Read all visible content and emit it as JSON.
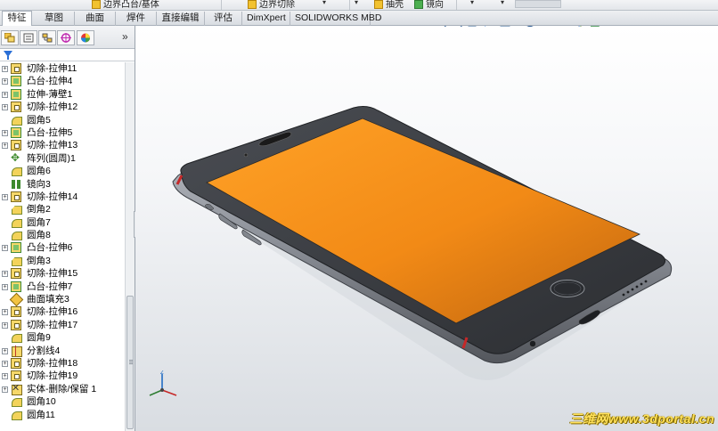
{
  "top_strip": {
    "items": [
      {
        "label": "边界凸台/基体"
      },
      {
        "label": "边界切除"
      },
      {
        "label": "抽壳"
      },
      {
        "label": "镜向"
      }
    ]
  },
  "tabs": [
    {
      "label": "特征",
      "active": true
    },
    {
      "label": "草图",
      "active": false
    },
    {
      "label": "曲面",
      "active": false
    },
    {
      "label": "焊件",
      "active": false
    },
    {
      "label": "直接编辑",
      "active": false
    },
    {
      "label": "评估",
      "active": false
    },
    {
      "label": "DimXpert",
      "active": false
    },
    {
      "label": "SOLIDWORKS MBD",
      "active": false
    }
  ],
  "feature_manager": {
    "toolbar_icons": [
      "featuremanager-tree-icon",
      "property-manager-icon",
      "configuration-manager-icon",
      "dimxpert-manager-icon",
      "display-manager-icon"
    ],
    "more": "»",
    "tree": [
      {
        "label": "切除-拉伸11",
        "icon": "cut",
        "expandable": true
      },
      {
        "label": "凸台-拉伸4",
        "icon": "boss",
        "expandable": true
      },
      {
        "label": "拉伸-薄壁1",
        "icon": "boss",
        "expandable": true
      },
      {
        "label": "切除-拉伸12",
        "icon": "cut",
        "expandable": true
      },
      {
        "label": "圆角5",
        "icon": "fillet",
        "expandable": false
      },
      {
        "label": "凸台-拉伸5",
        "icon": "boss",
        "expandable": true
      },
      {
        "label": "切除-拉伸13",
        "icon": "cut",
        "expandable": true
      },
      {
        "label": "阵列(圆周)1",
        "icon": "pattern",
        "expandable": false
      },
      {
        "label": "圆角6",
        "icon": "fillet",
        "expandable": false
      },
      {
        "label": "镜向3",
        "icon": "mirror",
        "expandable": false
      },
      {
        "label": "切除-拉伸14",
        "icon": "cut",
        "expandable": true
      },
      {
        "label": "倒角2",
        "icon": "chamfer",
        "expandable": false
      },
      {
        "label": "圆角7",
        "icon": "fillet",
        "expandable": false
      },
      {
        "label": "圆角8",
        "icon": "fillet",
        "expandable": false
      },
      {
        "label": "凸台-拉伸6",
        "icon": "boss",
        "expandable": true
      },
      {
        "label": "倒角3",
        "icon": "chamfer",
        "expandable": false
      },
      {
        "label": "切除-拉伸15",
        "icon": "cut",
        "expandable": true
      },
      {
        "label": "凸台-拉伸7",
        "icon": "boss",
        "expandable": true
      },
      {
        "label": "曲面填充3",
        "icon": "surf",
        "expandable": false
      },
      {
        "label": "切除-拉伸16",
        "icon": "cut",
        "expandable": true
      },
      {
        "label": "切除-拉伸17",
        "icon": "cut",
        "expandable": true
      },
      {
        "label": "圆角9",
        "icon": "fillet",
        "expandable": false
      },
      {
        "label": "分割线4",
        "icon": "split",
        "expandable": true
      },
      {
        "label": "切除-拉伸18",
        "icon": "cut",
        "expandable": true
      },
      {
        "label": "切除-拉伸19",
        "icon": "cut",
        "expandable": true
      },
      {
        "label": "实体-删除/保留 1",
        "icon": "body",
        "expandable": true
      },
      {
        "label": "圆角10",
        "icon": "fillet",
        "expandable": false
      },
      {
        "label": "圆角11",
        "icon": "fillet",
        "expandable": false
      }
    ]
  },
  "heads_up_toolbar": [
    "zoom-to-fit-icon",
    "zoom-area-icon",
    "previous-view-icon",
    "section-view-icon",
    "view-orientation-icon",
    "display-style-icon",
    "hide-show-items-icon",
    "edit-appearance-icon",
    "apply-scene-icon",
    "view-settings-icon"
  ],
  "model": {
    "name": "phone-model",
    "screen_color": "#f7931e",
    "frame_color": "#3a3d42"
  },
  "watermark": "三维网www.3dportal.cn",
  "colors": {
    "accent_blue": "#2b6fd6",
    "feature_yellow": "#f6d86a"
  }
}
